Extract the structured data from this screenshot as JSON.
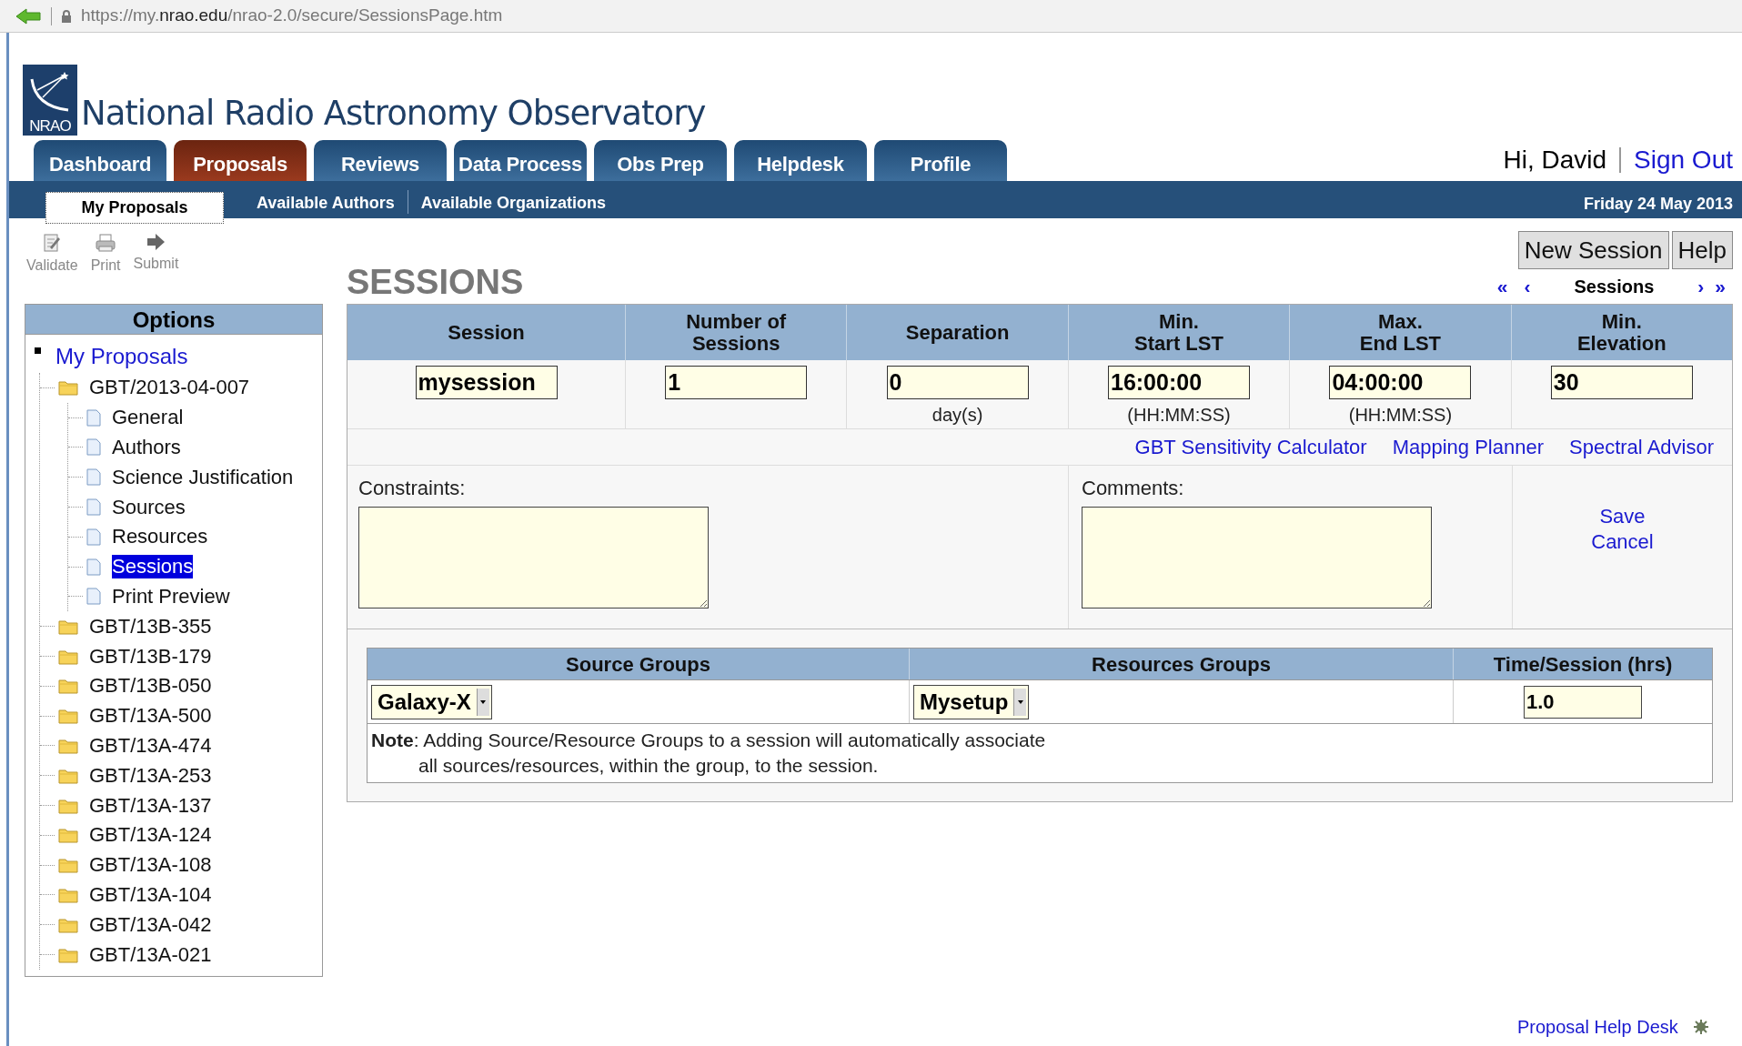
{
  "browser": {
    "url": "https://my.**nrao.edu**/nrao-2.0/secure/SessionsPage.htm"
  },
  "header": {
    "logo_text": "NRAO",
    "title": "National Radio Astronomy Observatory"
  },
  "tabs": [
    {
      "label": "Dashboard",
      "selected": false
    },
    {
      "label": "Proposals",
      "selected": true
    },
    {
      "label": "Reviews",
      "selected": false
    },
    {
      "label": "Data Process",
      "selected": false
    },
    {
      "label": "Obs Prep",
      "selected": false
    },
    {
      "label": "Helpdesk",
      "selected": false
    },
    {
      "label": "Profile",
      "selected": false
    }
  ],
  "user": {
    "greeting": "Hi, David",
    "sign_out": "Sign Out"
  },
  "subtabs": [
    {
      "label": "My Proposals",
      "selected": true
    },
    {
      "label": "Available Authors",
      "selected": false
    },
    {
      "label": "Available Organizations",
      "selected": false
    }
  ],
  "date": "Friday 24 May 2013",
  "toolbar": [
    {
      "label": "Validate",
      "kind": "validate"
    },
    {
      "label": "Print",
      "kind": "print"
    },
    {
      "label": "Submit",
      "kind": "submit"
    }
  ],
  "sidebar": {
    "title": "Options",
    "tree": {
      "label": "My Proposals",
      "selected": false,
      "children": [
        {
          "label": "GBT/2013-04-007",
          "kind": "folder",
          "selected": false,
          "children": [
            {
              "label": "General",
              "kind": "page",
              "selected": false
            },
            {
              "label": "Authors",
              "kind": "page",
              "selected": false
            },
            {
              "label": "Science Justification",
              "kind": "page",
              "selected": false
            },
            {
              "label": "Sources",
              "kind": "page",
              "selected": false
            },
            {
              "label": "Resources",
              "kind": "page",
              "selected": false
            },
            {
              "label": "Sessions",
              "kind": "page",
              "selected": true
            },
            {
              "label": "Print Preview",
              "kind": "page",
              "selected": false
            }
          ]
        },
        {
          "label": "GBT/13B-355",
          "kind": "folder",
          "selected": false
        },
        {
          "label": "GBT/13B-179",
          "kind": "folder",
          "selected": false
        },
        {
          "label": "GBT/13B-050",
          "kind": "folder",
          "selected": false
        },
        {
          "label": "GBT/13A-500",
          "kind": "folder",
          "selected": false
        },
        {
          "label": "GBT/13A-474",
          "kind": "folder",
          "selected": false
        },
        {
          "label": "GBT/13A-253",
          "kind": "folder",
          "selected": false
        },
        {
          "label": "GBT/13A-137",
          "kind": "folder",
          "selected": false
        },
        {
          "label": "GBT/13A-124",
          "kind": "folder",
          "selected": false
        },
        {
          "label": "GBT/13A-108",
          "kind": "folder",
          "selected": false
        },
        {
          "label": "GBT/13A-104",
          "kind": "folder",
          "selected": false
        },
        {
          "label": "GBT/13A-042",
          "kind": "folder",
          "selected": false
        },
        {
          "label": "GBT/13A-021",
          "kind": "folder",
          "selected": false
        }
      ]
    }
  },
  "page_title": "SESSIONS",
  "buttons": [
    "New Session",
    "Help"
  ],
  "pager": {
    "first": "«",
    "prev": "‹",
    "label": "Sessions",
    "next": "›",
    "last": "»"
  },
  "session_table": {
    "columns": [
      "Session",
      "Number of\nSessions",
      "Separation",
      "Min.\nStart LST",
      "Max.\nEnd LST",
      "Min.\nElevation"
    ],
    "fields": [
      {
        "value": "mysession"
      },
      {
        "value": "1"
      },
      {
        "value": "0",
        "hint": "day(s)"
      },
      {
        "value": "16:00:00",
        "hint": "(HH:MM:SS)"
      },
      {
        "value": "04:00:00",
        "hint": "(HH:MM:SS)"
      },
      {
        "value": "30"
      }
    ]
  },
  "tool_links": [
    "GBT Sensitivity Calculator",
    "Mapping Planner",
    "Spectral Advisor"
  ],
  "constraints": {
    "label": "Constraints:"
  },
  "comments": {
    "label": "Comments:"
  },
  "actions": [
    "Save",
    "Cancel"
  ],
  "groups": {
    "columns": [
      "Source Groups",
      "Resources Groups",
      "Time/Session (hrs)"
    ],
    "source": "Galaxy-X",
    "resource": "Mysetup",
    "time": "1.0",
    "note": "**Note**: Adding Source/Resource Groups to a session will automatically associate",
    "note_continued": "all sources/resources, within the group, to the session."
  },
  "footer": {
    "link": "Proposal Help Desk"
  }
}
